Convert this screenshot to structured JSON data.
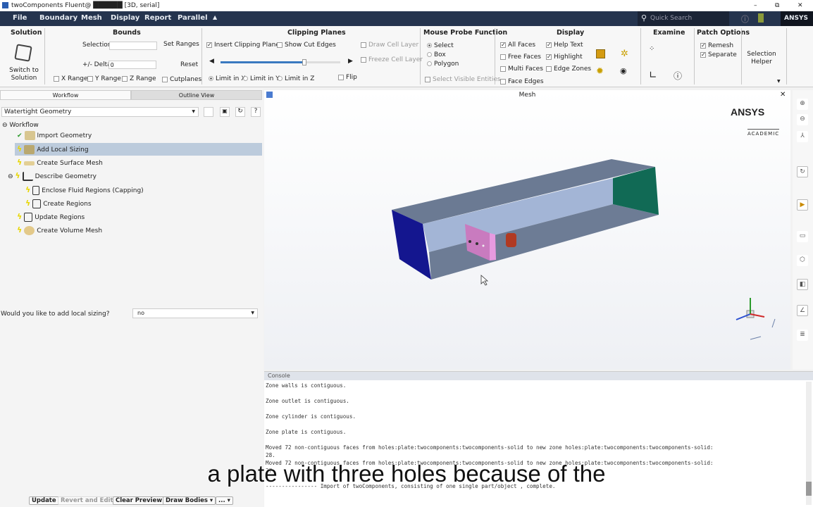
{
  "window": {
    "title": "twoComponents Fluent@ ██████ [3D, serial]",
    "min": "–",
    "max": "⧉",
    "close": "✕"
  },
  "menu": {
    "items": [
      "File",
      "Boundary",
      "Mesh",
      "Display",
      "Report",
      "Parallel",
      "▲"
    ],
    "search_placeholder": "Quick Search",
    "brand": "ANSYS"
  },
  "ribbon": {
    "solution": {
      "title": "Solution",
      "button": "Switch to Solution"
    },
    "bounds": {
      "title": "Bounds",
      "selection_label": "Selection",
      "selection_value": "",
      "set_ranges": "Set Ranges",
      "delta_label": "+/- Delta",
      "delta_value": "0",
      "reset": "Reset",
      "x_range": "X Range",
      "y_range": "Y Range",
      "z_range": "Z Range",
      "cutplanes": "Cutplanes"
    },
    "clipping": {
      "title": "Clipping Planes",
      "insert": "Insert Clipping Planes",
      "insert_checked": true,
      "show_cut_edges": "Show Cut Edges",
      "draw_cell_layer": "Draw Cell Layer",
      "freeze_cell_layer": "Freeze Cell Layer",
      "slider_value": 0.7,
      "limit_x": "Limit in X",
      "limit_y": "Limit in Y",
      "limit_z": "Limit in Z",
      "flip": "Flip"
    },
    "probe": {
      "title": "Mouse Probe Function",
      "options": [
        "Select",
        "Box",
        "Polygon"
      ],
      "selected": "Select",
      "select_visible": "Select Visible Entities"
    },
    "display": {
      "title": "Display",
      "all_faces": "All Faces",
      "free_faces": "Free Faces",
      "multi_faces": "Multi Faces",
      "face_edges": "Face Edges",
      "help_text": "Help Text",
      "highlight": "Highlight",
      "edge_zones": "Edge Zones"
    },
    "examine": {
      "title": "Examine"
    },
    "patch": {
      "title": "Patch Options",
      "remesh": "Remesh",
      "separate": "Separate"
    },
    "selection_helper": "Selection Helper"
  },
  "left": {
    "tabs": [
      "Workflow",
      "Outline View"
    ],
    "workflow_type": "Watertight Geometry",
    "tree_root": "Workflow",
    "tree": [
      {
        "label": "Import Geometry",
        "status": "done"
      },
      {
        "label": "Add Local Sizing",
        "status": "pending",
        "selected": true
      },
      {
        "label": "Create Surface Mesh",
        "status": "pending"
      },
      {
        "label": "Describe Geometry",
        "status": "pending"
      },
      {
        "label": "Enclose Fluid Regions (Capping)",
        "status": "pending"
      },
      {
        "label": "Create Regions",
        "status": "pending"
      },
      {
        "label": "Update Regions",
        "status": "pending"
      },
      {
        "label": "Create Volume Mesh",
        "status": "pending"
      }
    ],
    "question": "Would you like to add local sizing?",
    "answer": "no",
    "buttons": {
      "update": "Update",
      "revert": "Revert and Edit",
      "clear": "Clear Preview",
      "draw": "Draw Bodies",
      "more": "..."
    }
  },
  "viewport": {
    "title": "Mesh",
    "logo": "ANSYS",
    "logo_sub": "ACADEMIC"
  },
  "console": {
    "title": "Console",
    "lines": [
      "Zone walls is contiguous.",
      "",
      "Zone outlet is contiguous.",
      "",
      "Zone cylinder is contiguous.",
      "",
      "Zone plate is contiguous.",
      "",
      "Moved 72 non-contiguous faces from holes:plate:twocomponents:twocomponents-solid to new zone holes:plate:twocomponents:twocomponents-solid:",
      "28.",
      "Moved 72 non-contiguous faces from holes:plate:twocomponents:twocomponents-solid to new zone holes:plate:twocomponents:twocomponents-solid:",
      "27",
      "",
      "---------------- Import of twoComponents, consisting of one single part/object , complete."
    ]
  },
  "subtitle": "a plate with three holes because of the",
  "colors": {
    "menubar": "#25344e",
    "inlet": "#14168f",
    "outlet": "#116a55",
    "walls": "#6b7a93",
    "plate": "#d986cf",
    "cylinder": "#b13a22"
  }
}
